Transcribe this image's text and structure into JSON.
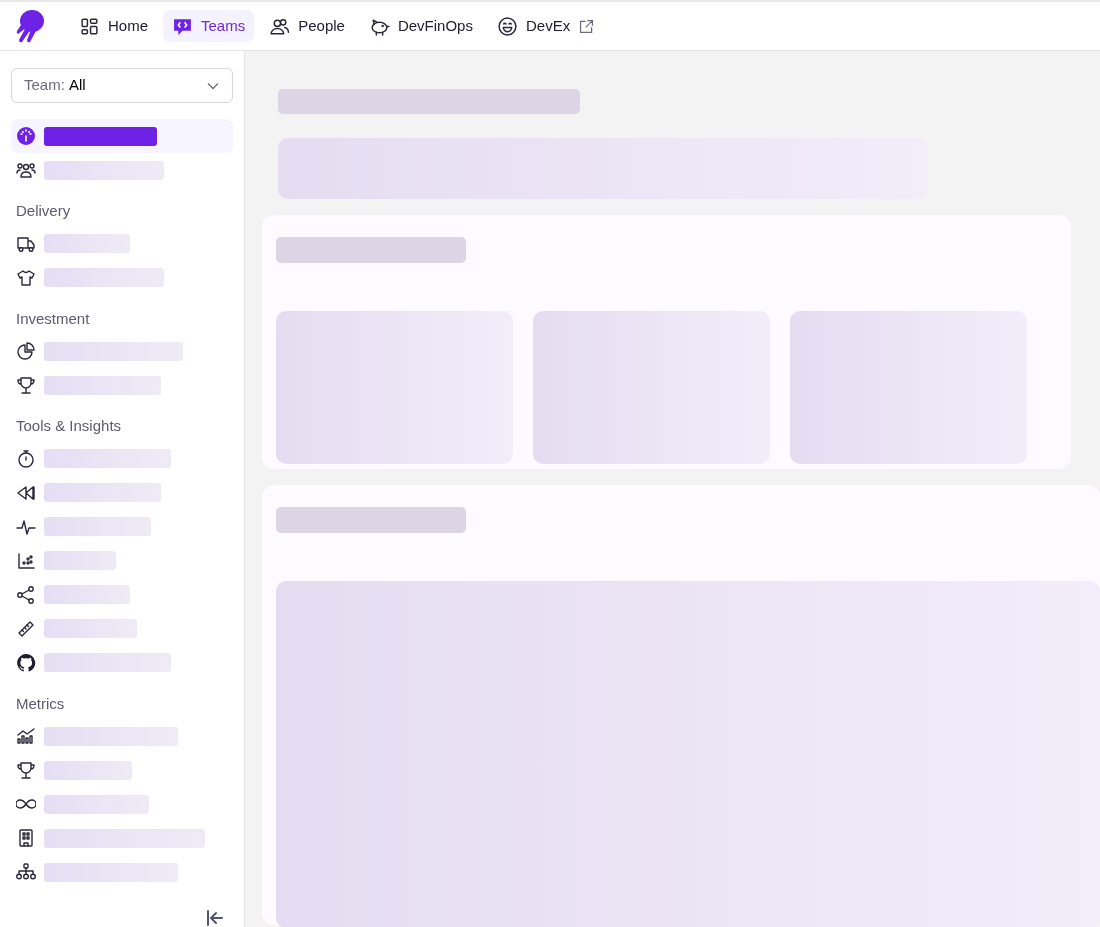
{
  "top_nav": [
    {
      "label": "Home",
      "kind": "grid",
      "selected": false,
      "external": false
    },
    {
      "label": "Teams",
      "kind": "chat-code",
      "selected": true,
      "external": false
    },
    {
      "label": "People",
      "kind": "people",
      "selected": false,
      "external": false
    },
    {
      "label": "DevFinOps",
      "kind": "piggy",
      "selected": false,
      "external": false
    },
    {
      "label": "DevEx",
      "kind": "smile",
      "selected": false,
      "external": true
    }
  ],
  "team_select": {
    "label": "Team:",
    "value": "All"
  },
  "sidebar": {
    "sections": [
      {
        "items": [
          {
            "kind": "gauge",
            "selected": true
          },
          {
            "kind": "group",
            "selected": false
          }
        ]
      },
      {
        "heading": "Delivery",
        "items": [
          {
            "kind": "truck",
            "selected": false
          },
          {
            "kind": "shirt",
            "selected": false
          }
        ]
      },
      {
        "heading": "Investment",
        "items": [
          {
            "kind": "pie",
            "selected": false
          },
          {
            "kind": "trophy",
            "selected": false
          }
        ]
      },
      {
        "heading": "Tools & Insights",
        "items": [
          {
            "kind": "stopwatch",
            "selected": false
          },
          {
            "kind": "rewind",
            "selected": false
          },
          {
            "kind": "pulse",
            "selected": false
          },
          {
            "kind": "scatter",
            "selected": false
          },
          {
            "kind": "share",
            "selected": false
          },
          {
            "kind": "ruler",
            "selected": false
          },
          {
            "kind": "github",
            "selected": false
          }
        ]
      },
      {
        "heading": "Metrics",
        "items": [
          {
            "kind": "barline",
            "selected": false
          },
          {
            "kind": "trophy",
            "selected": false
          },
          {
            "kind": "infinity",
            "selected": false
          },
          {
            "kind": "building",
            "selected": false
          },
          {
            "kind": "hierarchy",
            "selected": false
          }
        ]
      }
    ]
  }
}
